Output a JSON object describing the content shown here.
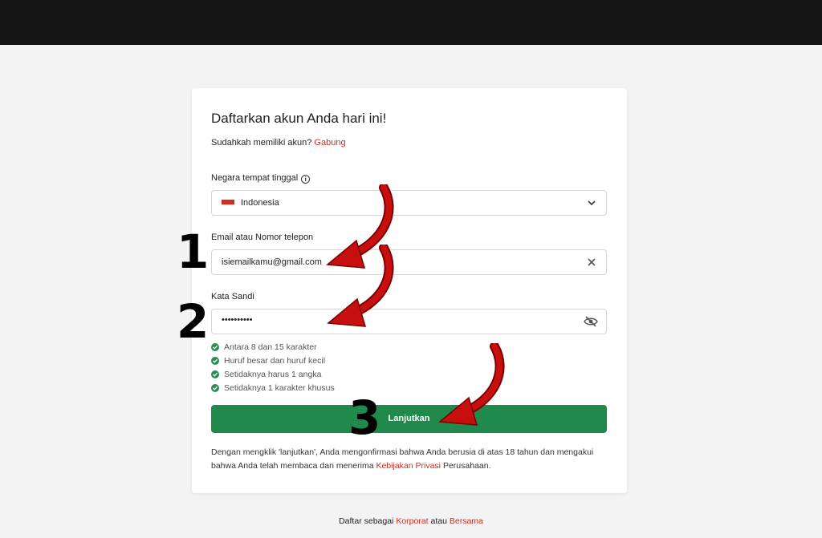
{
  "header": {
    "color": "#141414"
  },
  "form": {
    "title": "Daftarkan akun Anda hari ini!",
    "login_prompt": "Sudahkah memiliki akun?",
    "login_link": "Gabung",
    "country": {
      "label": "Negara tempat tinggal",
      "value": "Indonesia",
      "flag_icon": "indonesia-flag-icon",
      "info_icon": "info-icon",
      "dropdown_icon": "chevron-down-icon"
    },
    "email": {
      "label": "Email atau Nomor telepon",
      "value": "isiemailkamu@gmail.com",
      "clear_icon": "close-icon"
    },
    "password": {
      "label": "Kata Sandi",
      "value": "••••••••••",
      "toggle_icon": "eye-off-icon"
    },
    "rules": [
      "Antara 8 dan 15 karakter",
      "Huruf besar dan huruf kecil",
      "Setidaknya harus 1 angka",
      "Setidaknya 1 karakter khusus"
    ],
    "submit_label": "Lanjutkan",
    "disclaimer_prefix": "Dengan mengklik 'lanjutkan', Anda mengonfirmasi bahwa Anda berusia di atas 18 tahun dan mengakui bahwa Anda telah membaca dan menerima",
    "privacy_link": "Kebijakan Privasi",
    "disclaimer_suffix": "Perusahaan."
  },
  "footer": {
    "prefix": "Daftar sebagai",
    "corporate_link": "Korporat",
    "middle": "atau",
    "joint_link": "Bersama"
  },
  "annotations": {
    "steps": [
      "1",
      "2",
      "3"
    ],
    "arrow_color": "#c80f0f"
  },
  "colors": {
    "accent": "#1f8a4c",
    "link": "#d52b1e",
    "background": "#f3f3f3"
  }
}
